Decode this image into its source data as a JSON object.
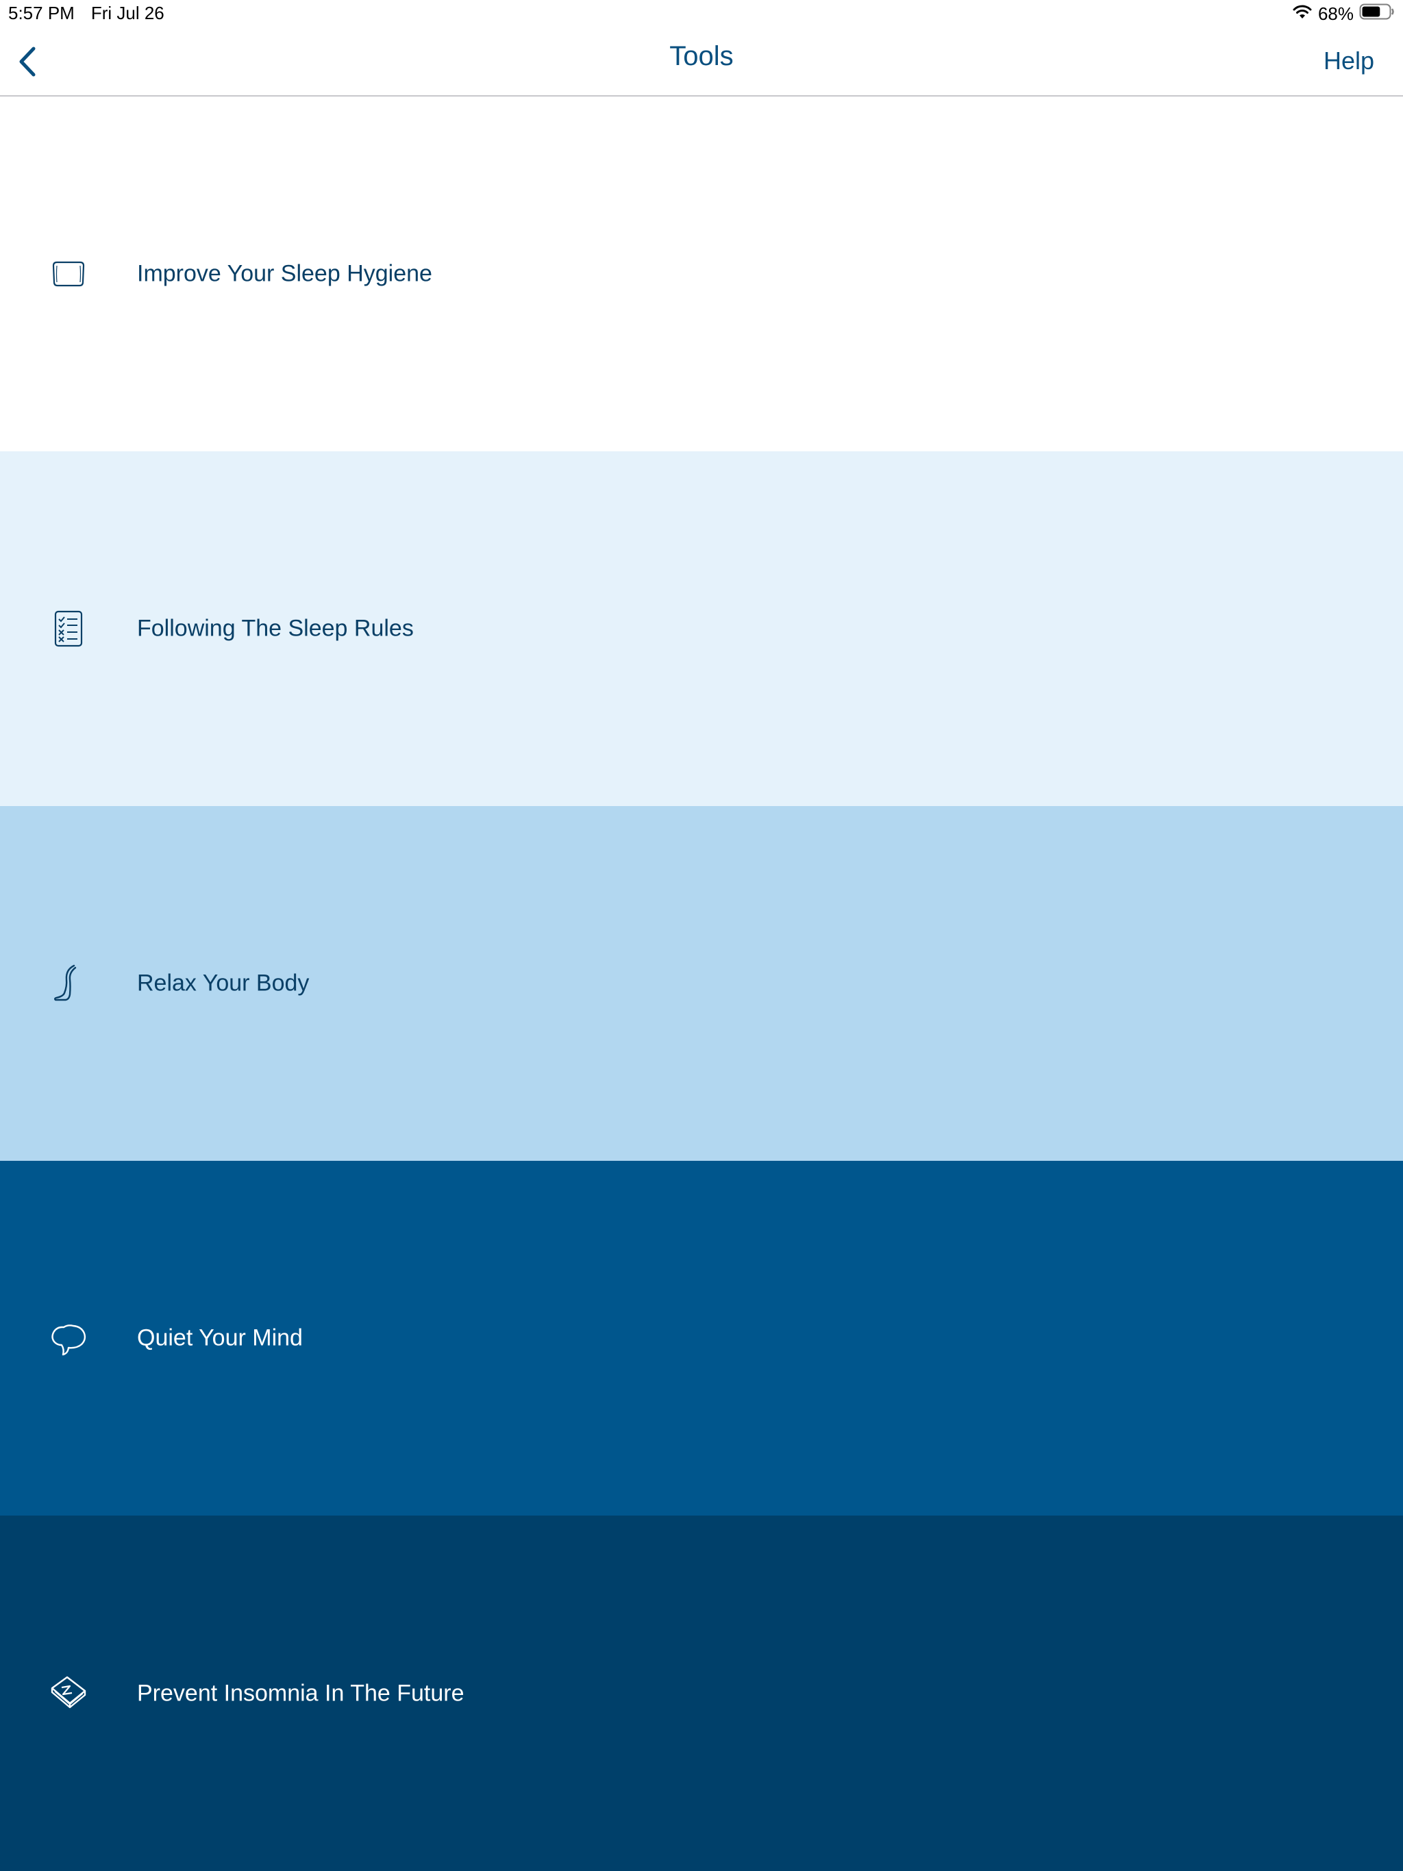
{
  "status_bar": {
    "time": "5:57 PM",
    "date": "Fri Jul 26",
    "battery_percent": "68%",
    "battery_level": 0.68
  },
  "nav": {
    "title": "Tools",
    "help_label": "Help"
  },
  "tools": [
    {
      "label": "Improve Your Sleep Hygiene",
      "icon": "pillow-icon"
    },
    {
      "label": "Following The Sleep Rules",
      "icon": "checklist-icon"
    },
    {
      "label": "Relax Your Body",
      "icon": "leg-icon"
    },
    {
      "label": "Quiet Your Mind",
      "icon": "brain-icon"
    },
    {
      "label": "Prevent Insomnia In The Future",
      "icon": "sleep-book-icon"
    }
  ],
  "colors": {
    "accent": "#0a4f7f",
    "row_1": "#ffffff",
    "row_2": "#e5f2fb",
    "row_3": "#b2d7f0",
    "row_4": "#00568d",
    "row_5": "#00406a"
  }
}
